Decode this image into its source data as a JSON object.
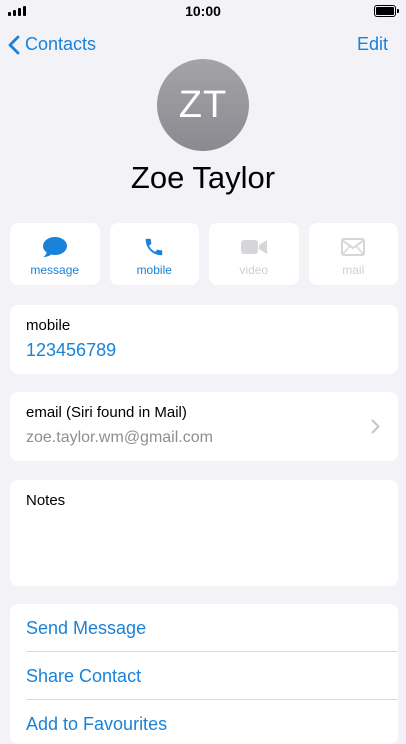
{
  "status_bar": {
    "time": "10:00"
  },
  "nav": {
    "back_label": "Contacts",
    "edit_label": "Edit"
  },
  "contact": {
    "initials": "ZT",
    "name": "Zoe Taylor"
  },
  "actions": [
    {
      "label": "message",
      "icon": "message-bubble-icon",
      "enabled": true
    },
    {
      "label": "mobile",
      "icon": "phone-icon",
      "enabled": true
    },
    {
      "label": "video",
      "icon": "video-camera-icon",
      "enabled": false
    },
    {
      "label": "mail",
      "icon": "envelope-icon",
      "enabled": false
    }
  ],
  "mobile": {
    "label": "mobile",
    "number": "123456789"
  },
  "email": {
    "label": "email (Siri found in Mail)",
    "address": "zoe.taylor.wm@gmail.com"
  },
  "notes": {
    "label": "Notes"
  },
  "links": [
    "Send Message",
    "Share Contact",
    "Add to Favourites"
  ],
  "colors": {
    "accent": "#1a82d8",
    "background": "#f2f2f7",
    "disabled": "#cfcfd3"
  }
}
